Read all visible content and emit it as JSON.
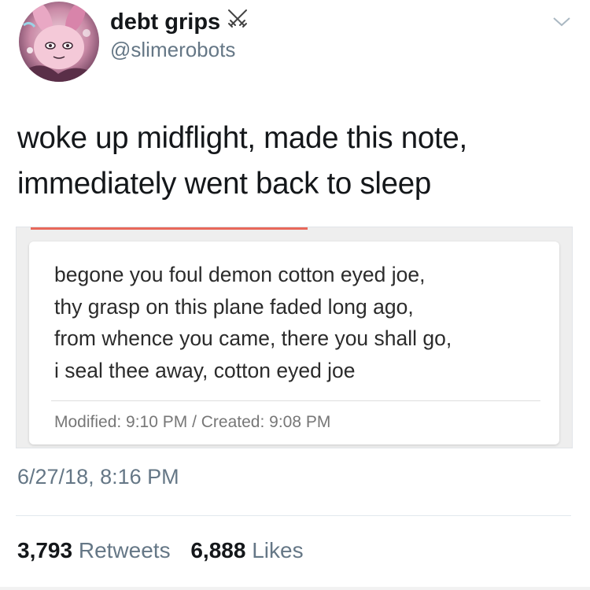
{
  "author": {
    "display_name": "debt grips",
    "handle": "@slimerobots",
    "name_emoji": "crossed-swords-icon"
  },
  "tweet": {
    "text_lines": [
      "woke up midflight, made this note,",
      "immediately went back to sleep"
    ],
    "timestamp": "6/27/18, 8:16 PM"
  },
  "note": {
    "lines": [
      "begone you foul demon cotton eyed joe,",
      "thy grasp on this plane faded long ago,",
      "from whence you came, there you shall go,",
      "i seal thee away, cotton eyed joe"
    ],
    "meta": "Modified: 9:10 PM / Created: 9:08 PM"
  },
  "stats": {
    "retweets_count": "3,793",
    "retweets_label": "Retweets",
    "likes_count": "6,888",
    "likes_label": "Likes"
  },
  "colors": {
    "text": "#14171a",
    "secondary": "#657786",
    "accent_bar": "#e8685a"
  }
}
